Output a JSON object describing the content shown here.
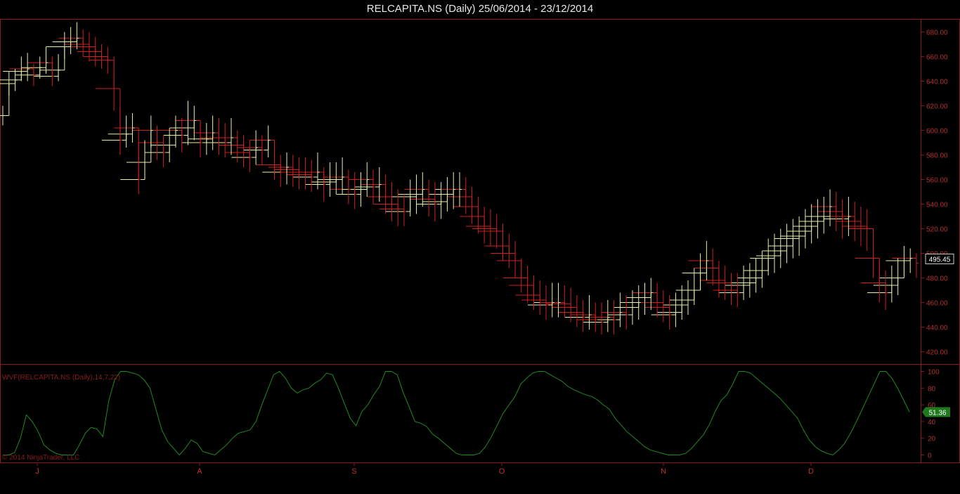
{
  "window": {
    "title": "RELCAPITA.NS (Daily)  25/06/2014 - 23/12/2014"
  },
  "colors": {
    "background": "#000000",
    "frame": "#8b1a1a",
    "up": "#e8f0a8",
    "down": "#d02020",
    "indicator": "#1f8a1f",
    "current_label_bg": "#1f7a1f"
  },
  "chart_data": [
    {
      "type": "line",
      "title": "RELCAPITA.NS (Daily)  25/06/2014 - 23/12/2014",
      "style": "price bars with step (Renko/Kagi-like) overlay",
      "ylim": [
        410,
        690
      ],
      "y_ticks": [
        420,
        440,
        460,
        480,
        500,
        520,
        540,
        560,
        580,
        600,
        620,
        640,
        660,
        680
      ],
      "y_tick_labels": [
        "420.00",
        "440.00",
        "460.00",
        "480.00",
        "500.00",
        "520.00",
        "540.00",
        "560.00",
        "580.00",
        "600.00",
        "620.00",
        "640.00",
        "660.00",
        "680.00"
      ],
      "x_tick_labels": [
        "J",
        "A",
        "S",
        "O",
        "N",
        "D"
      ],
      "current_value_label": "495.45",
      "series": [
        {
          "close": [
            612,
            638,
            641,
            648,
            650,
            645,
            651,
            655,
            644,
            649,
            668,
            672,
            675,
            670,
            668,
            664,
            660,
            657,
            634,
            592,
            597,
            602,
            560,
            574,
            600,
            590,
            582,
            588,
            600,
            596,
            602,
            608,
            590,
            593,
            598,
            594,
            590,
            594,
            588,
            582,
            578,
            586,
            584,
            592,
            572,
            566,
            570,
            568,
            566,
            564,
            562,
            566,
            556,
            558,
            560,
            562,
            552,
            548,
            552,
            560,
            554,
            556,
            546,
            540,
            536,
            534,
            546,
            548,
            552,
            544,
            540,
            542,
            548,
            552,
            552,
            546,
            538,
            530,
            522,
            520,
            518,
            506,
            500,
            494,
            480,
            474,
            466,
            462,
            458,
            460,
            460,
            459,
            456,
            452,
            448,
            450,
            446,
            444,
            448,
            446,
            452,
            450,
            456,
            460,
            464,
            468,
            460,
            456,
            450,
            452,
            458,
            462,
            470,
            484,
            494,
            488,
            478,
            476,
            470,
            468,
            474,
            476,
            480,
            486,
            496,
            498,
            502,
            506,
            512,
            514,
            518,
            522,
            526,
            530,
            538,
            534,
            528,
            530,
            526,
            522,
            520,
            496,
            476,
            468,
            474,
            480,
            494,
            496,
            492
          ],
          "bar_high": [
            620,
            648,
            650,
            660,
            663,
            654,
            660,
            668,
            660,
            662,
            680,
            684,
            688,
            682,
            680,
            676,
            670,
            668,
            660,
            618,
            612,
            614,
            590,
            592,
            612,
            604,
            596,
            602,
            612,
            610,
            624,
            620,
            606,
            606,
            612,
            610,
            606,
            610,
            600,
            596,
            592,
            600,
            596,
            604,
            588,
            580,
            582,
            580,
            578,
            578,
            576,
            582,
            570,
            574,
            574,
            578,
            568,
            566,
            566,
            574,
            568,
            570,
            564,
            558,
            552,
            548,
            560,
            564,
            566,
            560,
            558,
            558,
            562,
            566,
            566,
            562,
            554,
            546,
            538,
            536,
            532,
            524,
            516,
            510,
            496,
            490,
            482,
            478,
            474,
            476,
            476,
            474,
            472,
            466,
            462,
            466,
            460,
            460,
            462,
            462,
            468,
            466,
            470,
            474,
            476,
            480,
            476,
            470,
            466,
            468,
            474,
            478,
            488,
            500,
            510,
            504,
            494,
            490,
            484,
            484,
            490,
            492,
            496,
            502,
            512,
            516,
            520,
            524,
            528,
            530,
            536,
            540,
            544,
            546,
            552,
            550,
            544,
            546,
            542,
            538,
            536,
            514,
            494,
            486,
            490,
            496,
            506,
            504,
            500
          ],
          "bar_low": [
            604,
            628,
            632,
            640,
            640,
            636,
            642,
            646,
            636,
            640,
            658,
            662,
            666,
            660,
            656,
            652,
            650,
            646,
            616,
            580,
            586,
            590,
            548,
            560,
            586,
            576,
            570,
            574,
            586,
            582,
            588,
            592,
            578,
            580,
            584,
            580,
            578,
            580,
            574,
            570,
            566,
            572,
            572,
            578,
            560,
            554,
            556,
            554,
            552,
            552,
            550,
            552,
            542,
            546,
            548,
            548,
            540,
            536,
            538,
            546,
            540,
            542,
            532,
            526,
            522,
            522,
            530,
            532,
            538,
            530,
            526,
            528,
            534,
            536,
            538,
            532,
            524,
            516,
            508,
            506,
            504,
            494,
            488,
            480,
            468,
            460,
            454,
            450,
            446,
            448,
            448,
            448,
            444,
            440,
            436,
            438,
            436,
            434,
            436,
            434,
            440,
            438,
            442,
            446,
            450,
            454,
            448,
            444,
            438,
            440,
            446,
            450,
            458,
            470,
            478,
            474,
            464,
            462,
            458,
            456,
            462,
            464,
            468,
            472,
            482,
            484,
            488,
            492,
            496,
            498,
            504,
            508,
            512,
            516,
            522,
            518,
            512,
            514,
            510,
            506,
            502,
            480,
            460,
            454,
            460,
            466,
            482,
            484,
            480
          ]
        }
      ]
    },
    {
      "type": "line",
      "series_label": "WVF(RELCAPITA.NS (Daily),14,7,22)",
      "ylim": [
        -8,
        108
      ],
      "y_ticks": [
        0,
        20,
        40,
        60,
        80,
        100
      ],
      "y_tick_labels": [
        "0",
        "20",
        "40",
        "60",
        "80",
        "100"
      ],
      "current_value_label": "51.36",
      "watermark": "© 2014 NinjaTrader, LLC",
      "series": [
        {
          "name": "WVF",
          "values": [
            0,
            0,
            3,
            20,
            48,
            40,
            28,
            12,
            6,
            2,
            0,
            0,
            0,
            12,
            26,
            33,
            31,
            22,
            65,
            90,
            100,
            100,
            98,
            96,
            90,
            80,
            55,
            30,
            16,
            8,
            0,
            8,
            18,
            14,
            4,
            2,
            0,
            6,
            12,
            20,
            26,
            28,
            30,
            40,
            60,
            78,
            96,
            100,
            92,
            80,
            74,
            78,
            80,
            86,
            90,
            98,
            96,
            80,
            62,
            44,
            35,
            52,
            60,
            72,
            82,
            100,
            100,
            96,
            75,
            58,
            40,
            38,
            34,
            25,
            20,
            14,
            8,
            2,
            0,
            0,
            0,
            2,
            10,
            22,
            36,
            50,
            60,
            70,
            85,
            92,
            98,
            100,
            100,
            96,
            92,
            88,
            82,
            78,
            75,
            72,
            70,
            66,
            60,
            55,
            44,
            36,
            28,
            22,
            16,
            10,
            6,
            4,
            2,
            0,
            0,
            0,
            2,
            8,
            16,
            24,
            36,
            52,
            65,
            72,
            85,
            100,
            100,
            98,
            92,
            86,
            80,
            74,
            68,
            60,
            52,
            44,
            30,
            18,
            10,
            5,
            2,
            0,
            6,
            14,
            26,
            40,
            55,
            70,
            85,
            100,
            100,
            92,
            80,
            66,
            51.36
          ]
        }
      ]
    }
  ]
}
